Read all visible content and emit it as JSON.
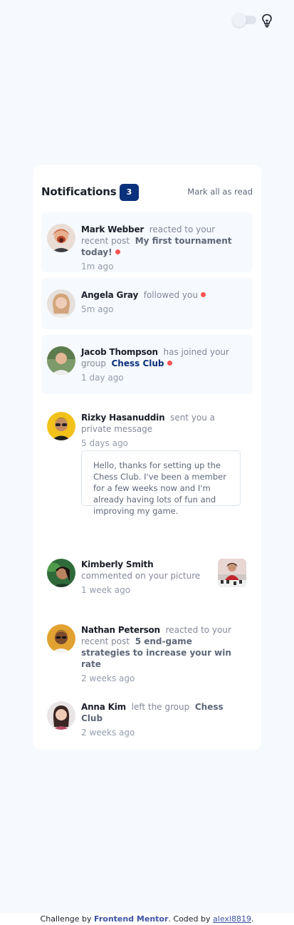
{
  "header": {
    "title": "Notifications",
    "unread_count": "3",
    "mark_all_label": "Mark all as read"
  },
  "notifications": [
    {
      "name": "Mark Webber",
      "action": "reacted to your recent post",
      "target": "My first tournament today!",
      "time": "1m ago",
      "unread": true,
      "avatar": "avatar-mark-webber"
    },
    {
      "name": "Angela Gray",
      "action": "followed you",
      "time": "5m ago",
      "unread": true,
      "avatar": "avatar-angela-gray"
    },
    {
      "name": "Jacob Thompson",
      "action": "has joined your group",
      "target": "Chess Club",
      "time": "1 day ago",
      "unread": true,
      "avatar": "avatar-jacob-thompson"
    },
    {
      "name": "Rizky Hasanuddin",
      "action": "sent you a private message",
      "time": "5 days ago",
      "message": "Hello, thanks for setting up the Chess Club. I've been a member for a few weeks now and I'm already having lots of fun and improving my game.",
      "unread": false,
      "avatar": "avatar-rizky-hasanuddin"
    },
    {
      "name": "Kimberly Smith",
      "action": "commented on your picture",
      "time": "1 week ago",
      "unread": false,
      "avatar": "avatar-kimberly-smith",
      "picture": "chess-picture-thumbnail"
    },
    {
      "name": "Nathan Peterson",
      "action": "reacted to your recent post",
      "target": "5 end-game strategies to increase your win rate",
      "time": "2 weeks ago",
      "unread": false,
      "avatar": "avatar-nathan-peterson"
    },
    {
      "name": "Anna Kim",
      "action": "left the group",
      "target": "Chess Club",
      "time": "2 weeks ago",
      "unread": false,
      "avatar": "avatar-anna-kim"
    }
  ],
  "footer": {
    "prefix": "Challenge by",
    "brand": "Frontend Mentor",
    "middle": ". Coded by",
    "author": "alexl8819",
    "suffix": "."
  },
  "icons": {
    "theme_toggle": "toggle-switch",
    "theme_icon": "lightbulb-icon"
  },
  "colors": {
    "badge": "#0a317b",
    "unread_dot": "#f65552",
    "unread_background": "#f6f9fd",
    "link": "#3e52a3"
  }
}
